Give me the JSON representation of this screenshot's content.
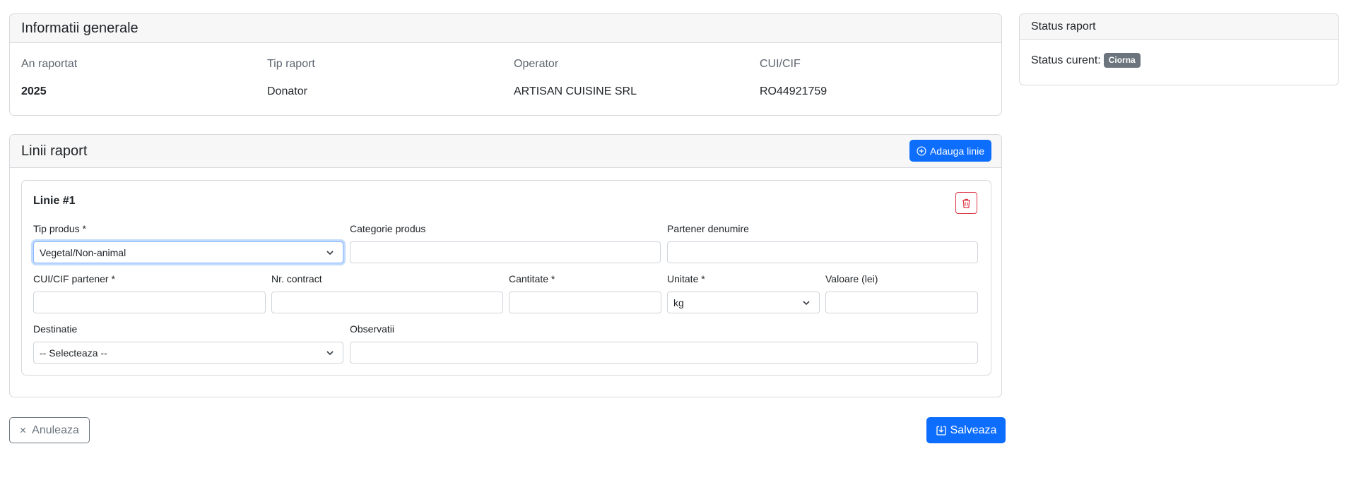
{
  "general": {
    "title": "Informatii generale",
    "fields": [
      {
        "label": "An raportat",
        "value": "2025"
      },
      {
        "label": "Tip raport",
        "value": "Donator"
      },
      {
        "label": "Operator",
        "value": "ARTISAN CUISINE SRL"
      },
      {
        "label": "CUI/CIF",
        "value": "RO44921759"
      }
    ]
  },
  "status": {
    "title": "Status raport",
    "current_label": "Status curent:",
    "badge": "Ciorna",
    "badge_color": "#6c757d"
  },
  "lines": {
    "title": "Linii raport",
    "add_button": "Adauga linie",
    "line": {
      "title": "Linie #1",
      "tip_produs": {
        "label": "Tip produs *",
        "value": "Vegetal/Non-animal"
      },
      "categorie_produs": {
        "label": "Categorie produs",
        "value": ""
      },
      "partener_denumire": {
        "label": "Partener denumire",
        "value": ""
      },
      "cui_partener": {
        "label": "CUI/CIF partener *",
        "value": ""
      },
      "nr_contract": {
        "label": "Nr. contract",
        "value": ""
      },
      "cantitate": {
        "label": "Cantitate *",
        "value": ""
      },
      "unitate": {
        "label": "Unitate *",
        "value": "kg"
      },
      "valoare": {
        "label": "Valoare (lei)",
        "value": ""
      },
      "destinatie": {
        "label": "Destinatie",
        "value": "-- Selecteaza --"
      },
      "observatii": {
        "label": "Observatii",
        "value": ""
      }
    }
  },
  "actions": {
    "cancel": "Anuleaza",
    "save": "Salveaza"
  },
  "colors": {
    "primary": "#0d6efd",
    "danger": "#dc3545",
    "secondary": "#6c757d"
  }
}
